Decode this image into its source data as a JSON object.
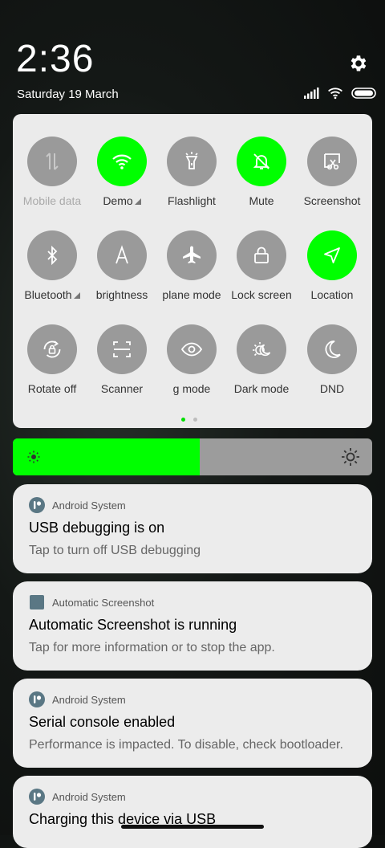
{
  "status": {
    "time": "2:36",
    "date": "Saturday 19 March"
  },
  "quick_settings": {
    "tiles": [
      {
        "label": "Mobile data",
        "icon": "mobile-data-icon",
        "state": "disabled"
      },
      {
        "label": "Demo",
        "icon": "wifi-icon",
        "state": "on",
        "has_expand": true
      },
      {
        "label": "Flashlight",
        "icon": "flashlight-icon",
        "state": "off"
      },
      {
        "label": "Mute",
        "icon": "bell-off-icon",
        "state": "on"
      },
      {
        "label": "Screenshot",
        "icon": "screenshot-icon",
        "state": "off"
      },
      {
        "label": "Bluetooth",
        "icon": "bluetooth-icon",
        "state": "off",
        "has_expand": true
      },
      {
        "label": "brightness",
        "icon": "auto-brightness-icon",
        "state": "off"
      },
      {
        "label": "plane mode",
        "icon": "airplane-icon",
        "state": "off"
      },
      {
        "label": "Lock screen",
        "icon": "lock-icon",
        "state": "off"
      },
      {
        "label": "Location",
        "icon": "location-icon",
        "state": "on"
      },
      {
        "label": "Rotate off",
        "icon": "rotate-lock-icon",
        "state": "off"
      },
      {
        "label": "Scanner",
        "icon": "scanner-icon",
        "state": "off"
      },
      {
        "label": "g mode",
        "icon": "eye-icon",
        "state": "off"
      },
      {
        "label": "Dark mode",
        "icon": "dark-mode-icon",
        "state": "off"
      },
      {
        "label": "DND",
        "icon": "moon-icon",
        "state": "off"
      }
    ],
    "page_count": 2,
    "active_page": 0
  },
  "brightness": {
    "level": 0.52,
    "accent": "#00ff00"
  },
  "notifications": [
    {
      "app": "Android System",
      "icon": "android-system-icon",
      "title": "USB debugging is on",
      "body": "Tap to turn off USB debugging"
    },
    {
      "app": "Automatic Screenshot",
      "icon": "app-square-icon",
      "title": "Automatic Screenshot is running",
      "body": "Tap for more information or to stop the app."
    },
    {
      "app": "Android System",
      "icon": "android-system-icon",
      "title": "Serial console enabled",
      "body": "Performance is impacted. To disable, check bootloader."
    },
    {
      "app": "Android System",
      "icon": "android-system-icon",
      "title": "Charging this device via USB",
      "body": ""
    }
  ]
}
